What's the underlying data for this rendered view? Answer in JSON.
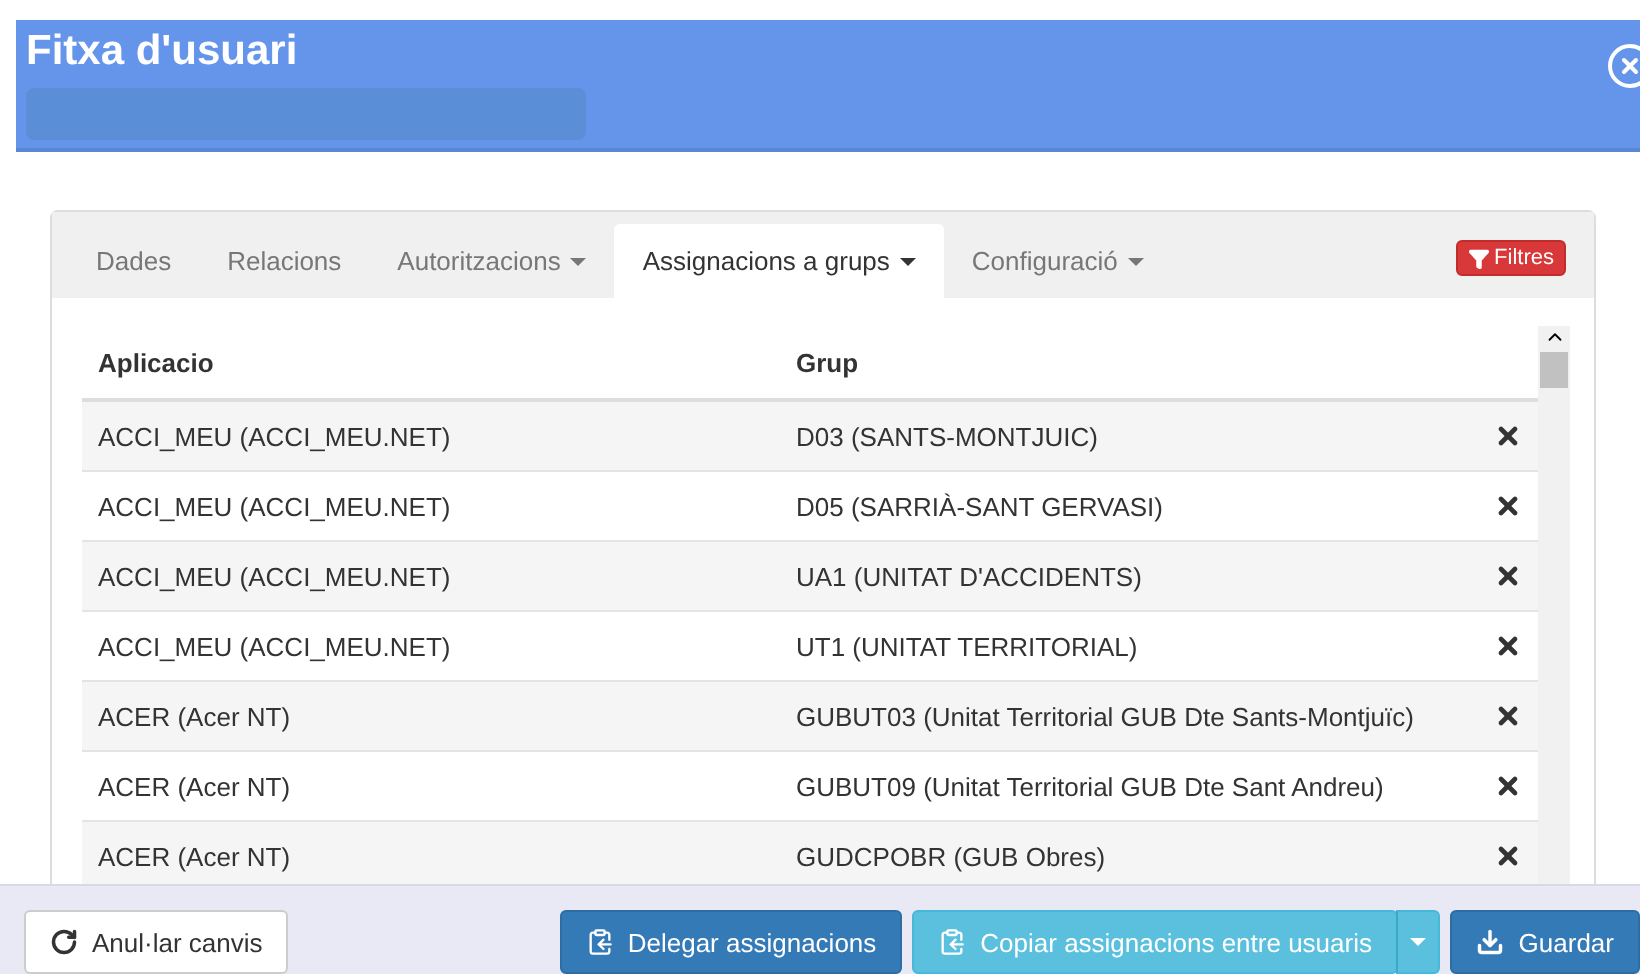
{
  "window": {
    "title": "Fitxa d'usuari"
  },
  "tabs": [
    {
      "label": "Dades",
      "selected": false,
      "dropdown": false
    },
    {
      "label": "Relacions",
      "selected": false,
      "dropdown": false
    },
    {
      "label": "Autoritzacions",
      "selected": false,
      "dropdown": true
    },
    {
      "label": "Assignacions a grups",
      "selected": true,
      "dropdown": true
    },
    {
      "label": "Configuració",
      "selected": false,
      "dropdown": true
    }
  ],
  "filter_button": "Filtres",
  "table": {
    "columns": [
      "Aplicacio",
      "Grup"
    ],
    "rows": [
      {
        "app": "ACCI_MEU (ACCI_MEU.NET)",
        "group": "D03 (SANTS-MONTJUIC)"
      },
      {
        "app": "ACCI_MEU (ACCI_MEU.NET)",
        "group": "D05 (SARRIÀ-SANT GERVASI)"
      },
      {
        "app": "ACCI_MEU (ACCI_MEU.NET)",
        "group": "UA1 (UNITAT D'ACCIDENTS)"
      },
      {
        "app": "ACCI_MEU (ACCI_MEU.NET)",
        "group": "UT1 (UNITAT TERRITORIAL)"
      },
      {
        "app": "ACER (Acer NT)",
        "group": "GUBUT03 (Unitat Territorial GUB Dte Sants-Montjuïc)"
      },
      {
        "app": "ACER (Acer NT)",
        "group": "GUBUT09 (Unitat Territorial GUB Dte Sant Andreu)"
      },
      {
        "app": "ACER (Acer NT)",
        "group": "GUDCPOBR (GUB Obres)"
      }
    ]
  },
  "footer": {
    "cancel": "Anul·lar canvis",
    "delegate": "Delegar assignacions",
    "copy": "Copiar assignacions entre usuaris",
    "save": "Guardar"
  }
}
